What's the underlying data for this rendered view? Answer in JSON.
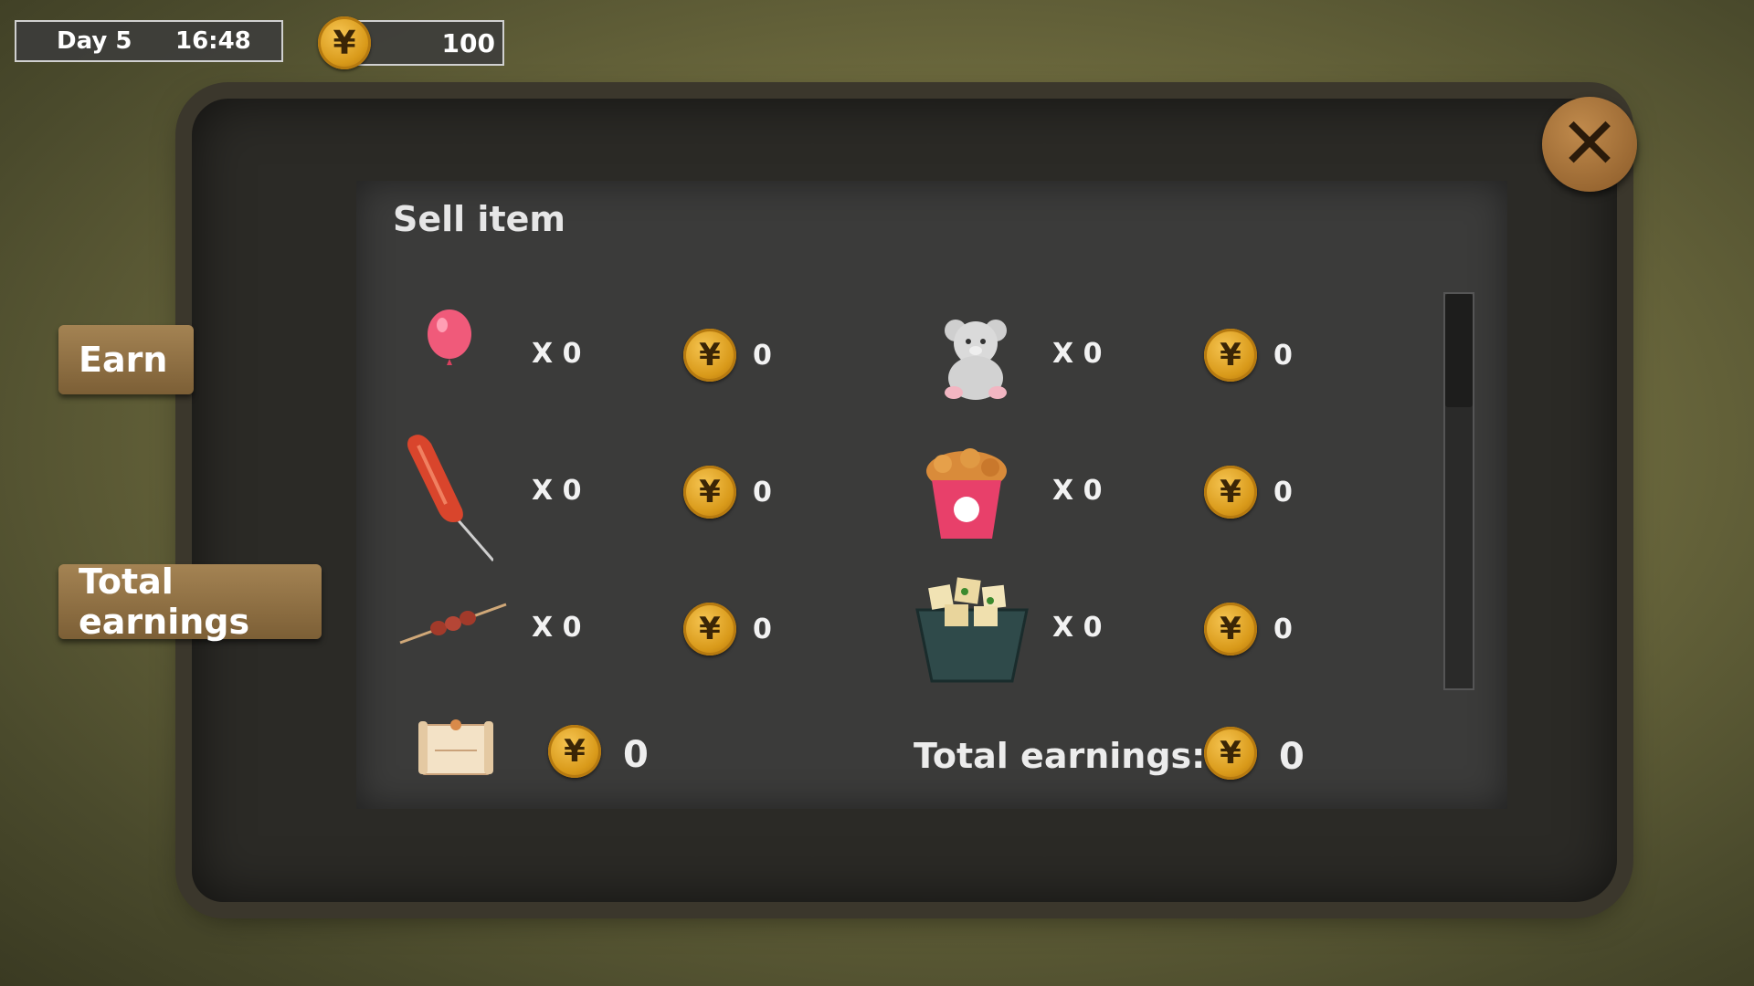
{
  "hud": {
    "day": "Day 5",
    "time": "16:48",
    "money": "100",
    "currency_symbol": "¥"
  },
  "side_tabs": {
    "earn": "Earn",
    "total": "Total earnings"
  },
  "panel": {
    "title": "Sell item"
  },
  "items": [
    {
      "name": "balloon",
      "qty": "X 0",
      "price": "0"
    },
    {
      "name": "teddy-bear",
      "qty": "X 0",
      "price": "0"
    },
    {
      "name": "sausage",
      "qty": "X 0",
      "price": "0"
    },
    {
      "name": "fried-chicken",
      "qty": "X 0",
      "price": "0"
    },
    {
      "name": "skewer",
      "qty": "X 0",
      "price": "0"
    },
    {
      "name": "tofu-bowl",
      "qty": "X 0",
      "price": "0"
    }
  ],
  "footer": {
    "ticket_value": "0",
    "total_label": "Total earnings:",
    "total_value": "0"
  },
  "close_symbol": "✕"
}
